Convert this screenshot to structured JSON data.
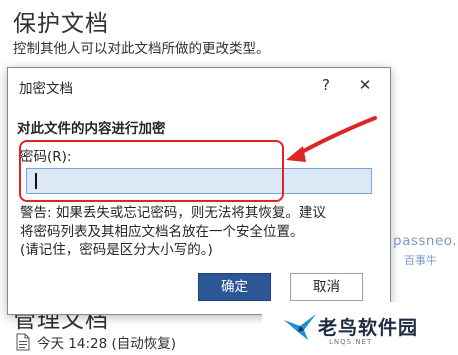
{
  "background": {
    "title": "保护文档",
    "description": "控制其他人可以对此文档所做的更改类型。",
    "section_title": "管理文档",
    "autosave_item": "今天 14:28 (自动恢复)"
  },
  "dialog": {
    "title": "加密文档",
    "help": "?",
    "close": "✕",
    "heading": "对此文件的内容进行加密",
    "password_label": "密码(R):",
    "password_value": "",
    "warning_lines": [
      "警告: 如果丢失或忘记密码，则无法将其恢复。建议",
      "将密码列表及其相应文档名放在一个安全位置。",
      "(请记住，密码是区分大小写的。)"
    ],
    "ok_label": "确定",
    "cancel_label": "取消"
  },
  "watermark": {
    "site": "passneo.cn",
    "site_sub": "百事牛",
    "brand": "老鸟软件园",
    "brand_url": "LNQS.NET"
  },
  "colors": {
    "primary_button": "#2b5797",
    "input_bg": "#dce8f6",
    "annotation": "#e02424"
  }
}
